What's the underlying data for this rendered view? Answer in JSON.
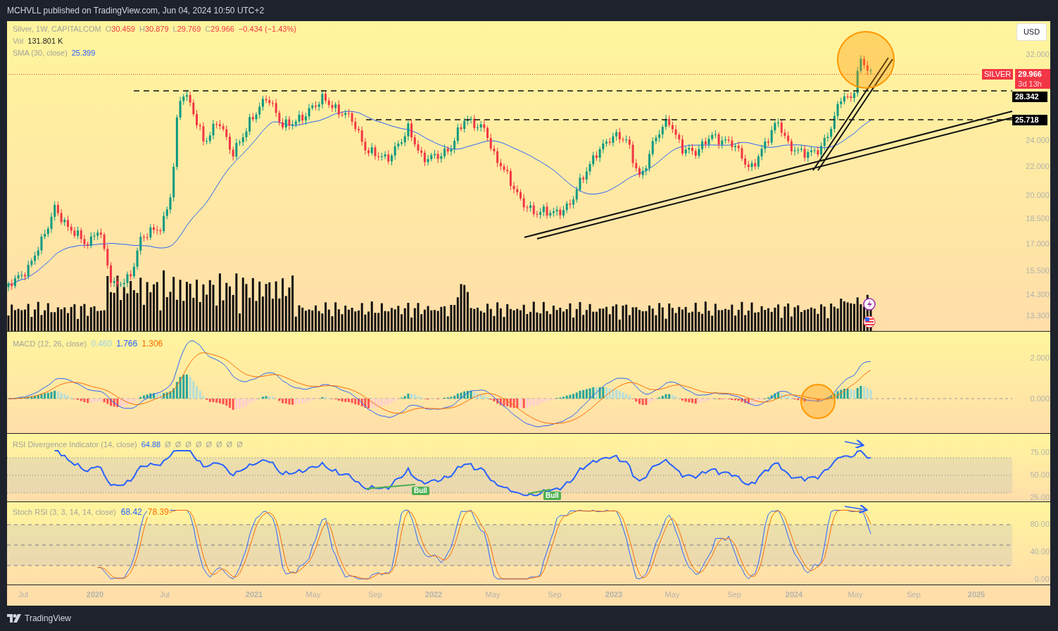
{
  "header": {
    "text": "MCHVLL published on TradingView.com, Jun 04, 2024 10:50 UTC+2"
  },
  "legend": {
    "symbol": "Silver, 1W, CAPITALCOM",
    "ohlc": [
      {
        "label": "O",
        "value": "30.459"
      },
      {
        "label": "H",
        "value": "30.879"
      },
      {
        "label": "L",
        "value": "29.769"
      },
      {
        "label": "C",
        "value": "29.966"
      }
    ],
    "change": "−0.434 (−1.43%)",
    "volume": {
      "label": "Vol",
      "value": "131.801 K"
    },
    "sma": {
      "label": "SMA (30, close)",
      "value": "25.399"
    }
  },
  "currency": "USD",
  "price_axis": [
    "32.000",
    "24.000",
    "22.000",
    "20.000",
    "18.500",
    "17.000",
    "15.500",
    "14.300",
    "13.300"
  ],
  "price_tags": [
    {
      "kind": "last",
      "symbol": "SILVER",
      "value": "29.966",
      "countdown": "3d 13h"
    },
    {
      "kind": "level",
      "value": "28.342"
    },
    {
      "kind": "level",
      "value": "25.718"
    }
  ],
  "macd": {
    "title": "MACD (12, 26, close)",
    "values": [
      {
        "value": "0.460",
        "color": "#a5d6e6"
      },
      {
        "value": "1.766",
        "color": "#2962ff"
      },
      {
        "value": "1.306",
        "color": "#ff6d00"
      }
    ],
    "axis": [
      "2.000",
      "0.000"
    ]
  },
  "rsi": {
    "title": "RSI Divergence Indicator (14, close)",
    "value": "64.88",
    "flags": [
      "Ø",
      "Ø",
      "Ø",
      "Ø",
      "Ø",
      "Ø",
      "Ø",
      "Ø"
    ],
    "axis": [
      "75.00",
      "50.00",
      "25.00"
    ],
    "signals": [
      {
        "label": "Bull"
      },
      {
        "label": "Bull"
      }
    ]
  },
  "stoch": {
    "title": "Stoch RSI (3, 3, 14, 14, close)",
    "values": [
      {
        "value": "68.42",
        "color": "#2962ff"
      },
      {
        "value": "78.39",
        "color": "#ff6d00"
      }
    ],
    "axis": [
      "80.00",
      "40.00",
      "0.00"
    ]
  },
  "time_axis": [
    {
      "label": "Jul",
      "kind": "month"
    },
    {
      "label": "2020",
      "kind": "year"
    },
    {
      "label": "Jul",
      "kind": "month"
    },
    {
      "label": "2021",
      "kind": "year"
    },
    {
      "label": "May",
      "kind": "month"
    },
    {
      "label": "Sep",
      "kind": "month"
    },
    {
      "label": "2022",
      "kind": "year"
    },
    {
      "label": "May",
      "kind": "month"
    },
    {
      "label": "Sep",
      "kind": "month"
    },
    {
      "label": "2023",
      "kind": "year"
    },
    {
      "label": "May",
      "kind": "month"
    },
    {
      "label": "Sep",
      "kind": "month"
    },
    {
      "label": "2024",
      "kind": "year"
    },
    {
      "label": "May",
      "kind": "month"
    },
    {
      "label": "Sep",
      "kind": "month"
    },
    {
      "label": "2025",
      "kind": "year"
    }
  ],
  "footer": {
    "brand": "TradingView"
  }
}
